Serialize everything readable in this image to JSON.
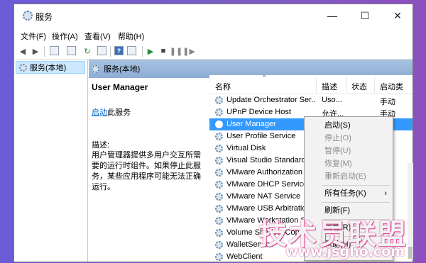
{
  "window": {
    "title": "服务",
    "controls": {
      "minimize": "—",
      "maximize": "☐",
      "close": "✕"
    }
  },
  "menu": [
    "文件(F)",
    "操作(A)",
    "查看(V)",
    "帮助(H)"
  ],
  "left_tree": {
    "root_label": "服务(本地)"
  },
  "right_header": {
    "label": "服务(本地)"
  },
  "description_panel": {
    "service_name": "User Manager",
    "start_link": "启动",
    "start_suffix": "此服务",
    "desc_label": "描述:",
    "desc_text": "用户管理器提供多用户交互所需要的运行时组件。如果停止此服务，某些应用程序可能无法正确运行。"
  },
  "columns": {
    "name": "名称",
    "description": "描述",
    "status": "状态",
    "startup": "启动类"
  },
  "services": [
    {
      "name": "Update Orchestrator Ser...",
      "description": "Uso...",
      "status": "",
      "startup": "手动"
    },
    {
      "name": "UPnP Device Host",
      "description": "允许...",
      "status": "",
      "startup": "手动"
    },
    {
      "name": "User Manager",
      "description": "",
      "status": "",
      "startup": ""
    },
    {
      "name": "User Profile Service",
      "description": "",
      "status": "",
      "startup": ""
    },
    {
      "name": "Virtual Disk",
      "description": "",
      "status": "",
      "startup": ""
    },
    {
      "name": "Visual Studio Standard",
      "description": "",
      "status": "",
      "startup": ""
    },
    {
      "name": "VMware Authorization",
      "description": "",
      "status": "",
      "startup": ""
    },
    {
      "name": "VMware DHCP Service",
      "description": "",
      "status": "",
      "startup": ""
    },
    {
      "name": "VMware NAT Service",
      "description": "",
      "status": "",
      "startup": ""
    },
    {
      "name": "VMware USB Arbitration",
      "description": "",
      "status": "",
      "startup": ""
    },
    {
      "name": "VMware Workstation S",
      "description": "",
      "status": "",
      "startup": ""
    },
    {
      "name": "Volume Shadow Copy",
      "description": "",
      "status": "",
      "startup": ""
    },
    {
      "name": "WalletService",
      "description": "",
      "status": "",
      "startup": ""
    },
    {
      "name": "WebClient",
      "description": "",
      "status": "",
      "startup": ""
    }
  ],
  "context_menu": {
    "start": "启动(S)",
    "stop": "停止(O)",
    "pause": "暂停(U)",
    "resume": "恢复(M)",
    "restart": "重新启动(E)",
    "all_tasks": "所有任务(K)",
    "refresh": "刷新(F)",
    "properties": "属性(R)",
    "help": "帮助(H)"
  },
  "watermark": {
    "text": "技术员联盟",
    "url": "www.jsgho.com"
  },
  "colors": {
    "selection": "#3399ff",
    "header_band": "#8eadd4",
    "link": "#0066cc"
  }
}
